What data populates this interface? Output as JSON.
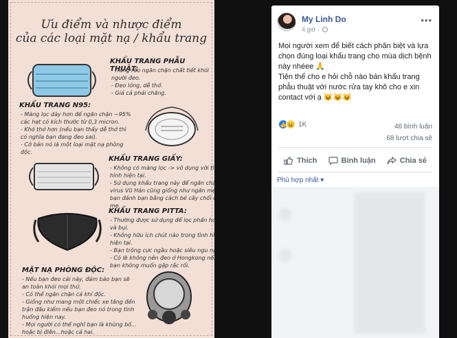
{
  "infographic": {
    "title_line1": "Ưu điểm và nhược điểm",
    "title_line2": "của các loại mặt nạ / khẩu trang",
    "sections": [
      {
        "heading": "KHẨU TRANG PHẪU THUẬT:",
        "lines": [
          "- Hàng rào ngăn chặn chất tiết khỏi",
          "người đeo.",
          "- Đeo lỏng, dễ thở.",
          "- Giá cả phải chăng."
        ]
      },
      {
        "heading": "KHẨU TRANG N95:",
        "lines": [
          "- Màng lọc dày hơn để ngăn chặn ~95%",
          "các hạt có kích thước từ 0,3 micron.",
          "- Khó thở hơn (nếu bạn thấy dễ thở thì",
          "có nghĩa bạn đang đeo sai).",
          "- Cớ bán nó là một loại mặt nạ phòng",
          "độc."
        ]
      },
      {
        "heading": "KHẨU TRANG GIẤY:",
        "lines": [
          "- Không có màng lọc -> vô dụng với tình",
          "hình hiện tại.",
          "- Sử dụng khẩu trang này để ngăn chặn",
          "virus Vũ Hán cũng giống như ngăn mẹ",
          "bạn đánh bạn bằng cách bẻ cây chổi của",
          "mẹ."
        ]
      },
      {
        "heading": "KHẨU TRANG PITTA:",
        "lines": [
          "- Thường được sử dụng để lọc phấn hoa",
          "và bụi.",
          "- Không hữu ích chút nào trong tình hình",
          "hiện tại.",
          "- Bạn trông cực ngầu hoặc siêu ngu ngốc.",
          "- Có lẽ không nên đeo ở Hongkong nếu",
          "bạn không muốn gặp rắc rối."
        ]
      },
      {
        "heading": "MẶT NẠ PHÒNG ĐỘC:",
        "lines": [
          "- Nếu bạn đeo cái này, đảm bảo bạn sẽ",
          "an toàn khỏi mọi thứ.",
          "- Có thể ngăn chặn cả khí độc.",
          "- Giống như mang một chiếc xe tăng đến",
          "trận đấu kiếm nếu bạn đeo nó trong tình",
          "huống hiện nay.",
          "- Mọi người có thể nghĩ bạn là khùng bố...",
          "hoặc bị điên...hoặc cả hai."
        ]
      }
    ]
  },
  "post": {
    "author": "My Linh Do",
    "time": "4 giờ",
    "text_p1": "Mọi người xem để biết cách phân biệt và lựa chọn đúng loại khẩu trang cho mùa dịch bệnh này nhéee 🙏",
    "text_p2": "Tiện thể cho e hỏi chỗ nào bán khẩu trang phẫu thuật với nước rửa tay khô cho e xin contact với ạ 😺😺😺",
    "reactions_count": "1K",
    "comments_count": "46 bình luận",
    "shares_count": "68 lượt chia sẻ",
    "actions": {
      "like": "Thích",
      "comment": "Bình luận",
      "share": "Chia sẻ"
    },
    "sort_label": "Phù hợp nhất ▾",
    "icons": {
      "like": "thumbs-up-icon",
      "comment": "speech-bubble-icon",
      "share": "share-arrow-icon"
    }
  }
}
